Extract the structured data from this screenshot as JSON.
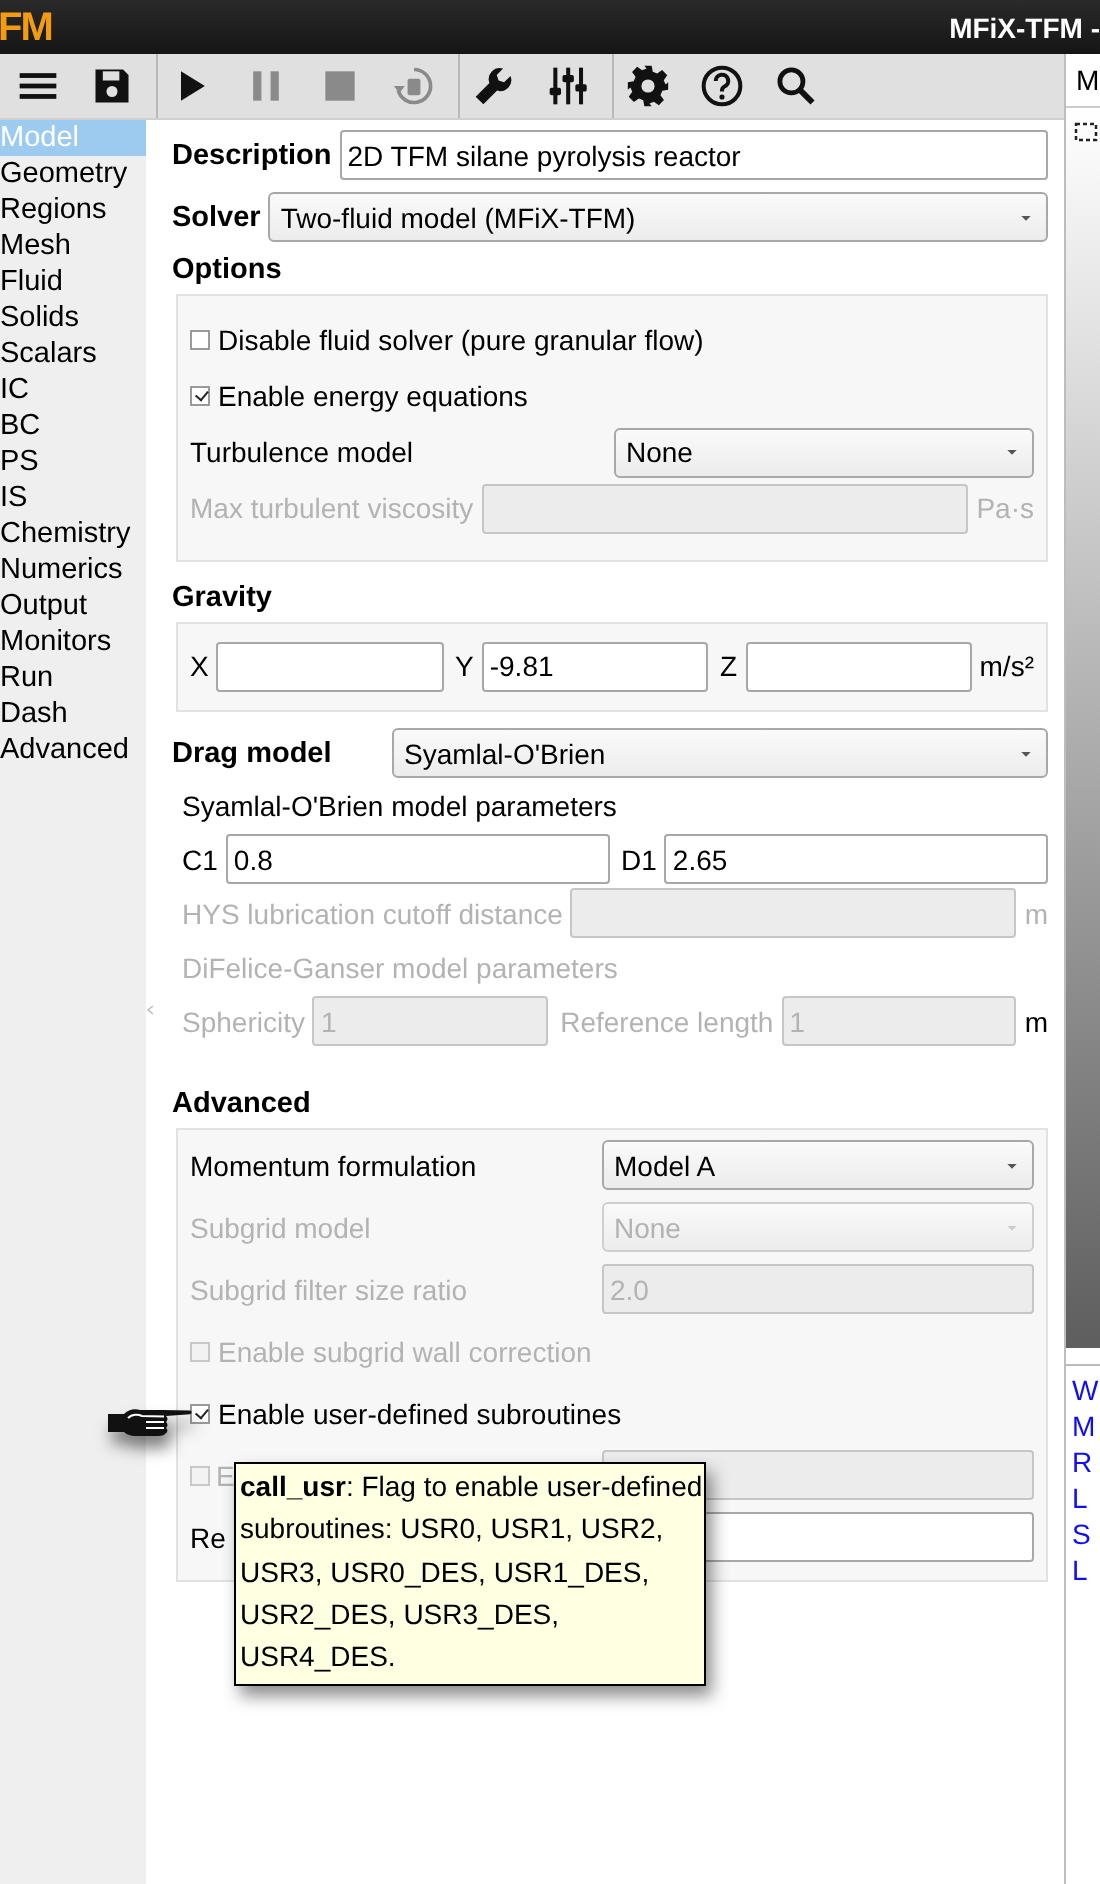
{
  "window": {
    "logo": "FM",
    "title": "MFiX-TFM -"
  },
  "toolbar": {
    "groups": [
      {
        "buttons": [
          {
            "kind": "menu",
            "disabled": false
          },
          {
            "kind": "save",
            "disabled": false
          }
        ]
      },
      {
        "buttons": [
          {
            "kind": "play",
            "disabled": false
          },
          {
            "kind": "pause",
            "disabled": true
          },
          {
            "kind": "stop",
            "disabled": true
          },
          {
            "kind": "reset",
            "disabled": true
          }
        ]
      },
      {
        "buttons": [
          {
            "kind": "wrench",
            "disabled": false
          },
          {
            "kind": "sliders",
            "disabled": false
          }
        ]
      },
      {
        "buttons": [
          {
            "kind": "settings",
            "disabled": false
          },
          {
            "kind": "help",
            "disabled": false
          },
          {
            "kind": "search",
            "disabled": false
          }
        ]
      }
    ]
  },
  "sidebar": {
    "items": [
      {
        "label": "Model",
        "selected": true
      },
      {
        "label": "Geometry",
        "selected": false
      },
      {
        "label": "Regions",
        "selected": false
      },
      {
        "label": "Mesh",
        "selected": false
      },
      {
        "label": "Fluid",
        "selected": false
      },
      {
        "label": "Solids",
        "selected": false
      },
      {
        "label": "Scalars",
        "selected": false
      },
      {
        "label": "IC",
        "selected": false
      },
      {
        "label": "BC",
        "selected": false
      },
      {
        "label": "PS",
        "selected": false
      },
      {
        "label": "IS",
        "selected": false
      },
      {
        "label": "Chemistry",
        "selected": false
      },
      {
        "label": "Numerics",
        "selected": false
      },
      {
        "label": "Output",
        "selected": false
      },
      {
        "label": "Monitors",
        "selected": false
      },
      {
        "label": "Run",
        "selected": false
      },
      {
        "label": "Dash",
        "selected": false
      },
      {
        "label": "Advanced",
        "selected": false
      }
    ]
  },
  "main": {
    "description": {
      "label": "Description",
      "value": "2D TFM silane pyrolysis reactor"
    },
    "solver": {
      "label": "Solver",
      "value": "Two-fluid model (MFiX-TFM)"
    },
    "groups": [
      {
        "title": "Options",
        "boxed": true,
        "rows": [
          {
            "kind": "checkbox",
            "label": "Disable fluid solver (pure granular flow)",
            "checked": false,
            "disabled": false
          },
          {
            "kind": "checkbox",
            "label": "Enable energy equations",
            "checked": true,
            "disabled": false
          },
          {
            "kind": "select",
            "label": "Turbulence model",
            "value": "None",
            "disabled": false
          },
          {
            "kind": "input",
            "label": "Max turbulent viscosity",
            "unit": "Pa·s",
            "disabled": true
          }
        ]
      },
      {
        "title": "Gravity",
        "boxed": true,
        "rows": [
          {
            "kind": "fields",
            "fields": [
              {
                "label": "X",
                "disabled": false
              },
              {
                "label": "Y",
                "value": "-9.81",
                "disabled": false
              },
              {
                "label": "Z",
                "disabled": false
              }
            ],
            "unit": "m/s²",
            "disabled": false
          }
        ]
      },
      {
        "title": "Drag model",
        "select": "Syamlal-O'Brien",
        "boxed": false,
        "rows": [
          {
            "kind": "note",
            "label": "Syamlal-O'Brien model parameters",
            "disabled": false
          },
          {
            "kind": "fields",
            "fields": [
              {
                "label": "C1",
                "value": "0.8",
                "disabled": false
              },
              {
                "label": "D1",
                "value": "2.65",
                "disabled": false
              }
            ]
          },
          {
            "kind": "input",
            "label": "HYS lubrication cutoff distance",
            "unit": "m",
            "disabled": true
          },
          {
            "kind": "note",
            "label": "DiFelice-Ganser model parameters",
            "disabled": true
          },
          {
            "kind": "fields",
            "fields": [
              {
                "label": "Sphericity",
                "value": "1",
                "disabled": true
              },
              {
                "label": "Reference length",
                "value": "1",
                "disabled": true
              }
            ],
            "unit": "m",
            "disabled": false
          }
        ]
      },
      {
        "title": "Advanced",
        "boxed": true,
        "rows": [
          {
            "kind": "select",
            "label": "Momentum formulation",
            "value": "Model A",
            "disabled": false
          },
          {
            "kind": "select",
            "label": "Subgrid model",
            "value": "None",
            "disabled": true
          },
          {
            "kind": "input",
            "label": "Subgrid filter size ratio",
            "value": "2.0",
            "disabled": true
          },
          {
            "kind": "checkbox",
            "label": "Enable subgrid wall correction",
            "checked": false,
            "disabled": true
          },
          {
            "kind": "checkbox",
            "label": "Enable user-defined subroutines",
            "checked": true,
            "disabled": false
          },
          {
            "kind": "checkbox-input",
            "label": "E",
            "checked": false,
            "disabled": true
          },
          {
            "kind": "input",
            "label": "Re",
            "disabled": false
          }
        ]
      }
    ],
    "tooltip": {
      "text": "**call_usr**: Flag to enable user-defined subroutines: USR0, USR1, USR2, USR3, USR0_DES, USR1_DES, USR2_DES, USR3_DES, USR4_DES."
    }
  },
  "right_panel": {
    "tab": "M",
    "links": [
      "W",
      "M",
      "R",
      "L",
      "S",
      "L"
    ]
  }
}
